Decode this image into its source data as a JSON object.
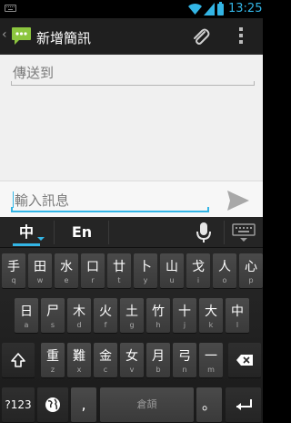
{
  "status_bar": {
    "time": "13:25",
    "icons": [
      "keyboard-icon",
      "wifi-icon",
      "signal-icon",
      "battery-icon"
    ],
    "accent_color": "#33b5e5"
  },
  "action_bar": {
    "back_glyph": "‹",
    "title": "新增簡訊",
    "icons": [
      "messaging-app-icon",
      "attach-icon",
      "overflow-menu-icon"
    ]
  },
  "compose": {
    "to_placeholder": "傳送到",
    "message_placeholder": "輸入訊息",
    "send_icon": "send-icon"
  },
  "ime": {
    "tab_chinese": "中",
    "tab_english": "En",
    "mic_icon": "microphone-icon",
    "switch_icon": "keyboard-switch-icon"
  },
  "keyboard": {
    "row1": [
      {
        "main": "手",
        "sub": "q"
      },
      {
        "main": "田",
        "sub": "w"
      },
      {
        "main": "水",
        "sub": "e"
      },
      {
        "main": "口",
        "sub": "r"
      },
      {
        "main": "廿",
        "sub": "t"
      },
      {
        "main": "卜",
        "sub": "y"
      },
      {
        "main": "山",
        "sub": "u"
      },
      {
        "main": "戈",
        "sub": "i"
      },
      {
        "main": "人",
        "sub": "o"
      },
      {
        "main": "心",
        "sub": "p"
      }
    ],
    "row2": [
      {
        "main": "日",
        "sub": "a"
      },
      {
        "main": "尸",
        "sub": "s"
      },
      {
        "main": "木",
        "sub": "d"
      },
      {
        "main": "火",
        "sub": "f"
      },
      {
        "main": "土",
        "sub": "g"
      },
      {
        "main": "竹",
        "sub": "h"
      },
      {
        "main": "十",
        "sub": "j"
      },
      {
        "main": "大",
        "sub": "k"
      },
      {
        "main": "中",
        "sub": "l"
      }
    ],
    "row3": [
      {
        "main": "重",
        "sub": "z"
      },
      {
        "main": "難",
        "sub": "x"
      },
      {
        "main": "金",
        "sub": "c"
      },
      {
        "main": "女",
        "sub": "v"
      },
      {
        "main": "月",
        "sub": "b"
      },
      {
        "main": "弓",
        "sub": "n"
      },
      {
        "main": "一",
        "sub": "m"
      }
    ],
    "shift_icon": "shift-icon",
    "backspace_icon": "backspace-icon",
    "symbols_label": "?123",
    "globe_icon": "globe-icon",
    "comma_label": ",",
    "space_label": "倉頡",
    "period_label": "。",
    "enter_icon": "enter-icon"
  }
}
